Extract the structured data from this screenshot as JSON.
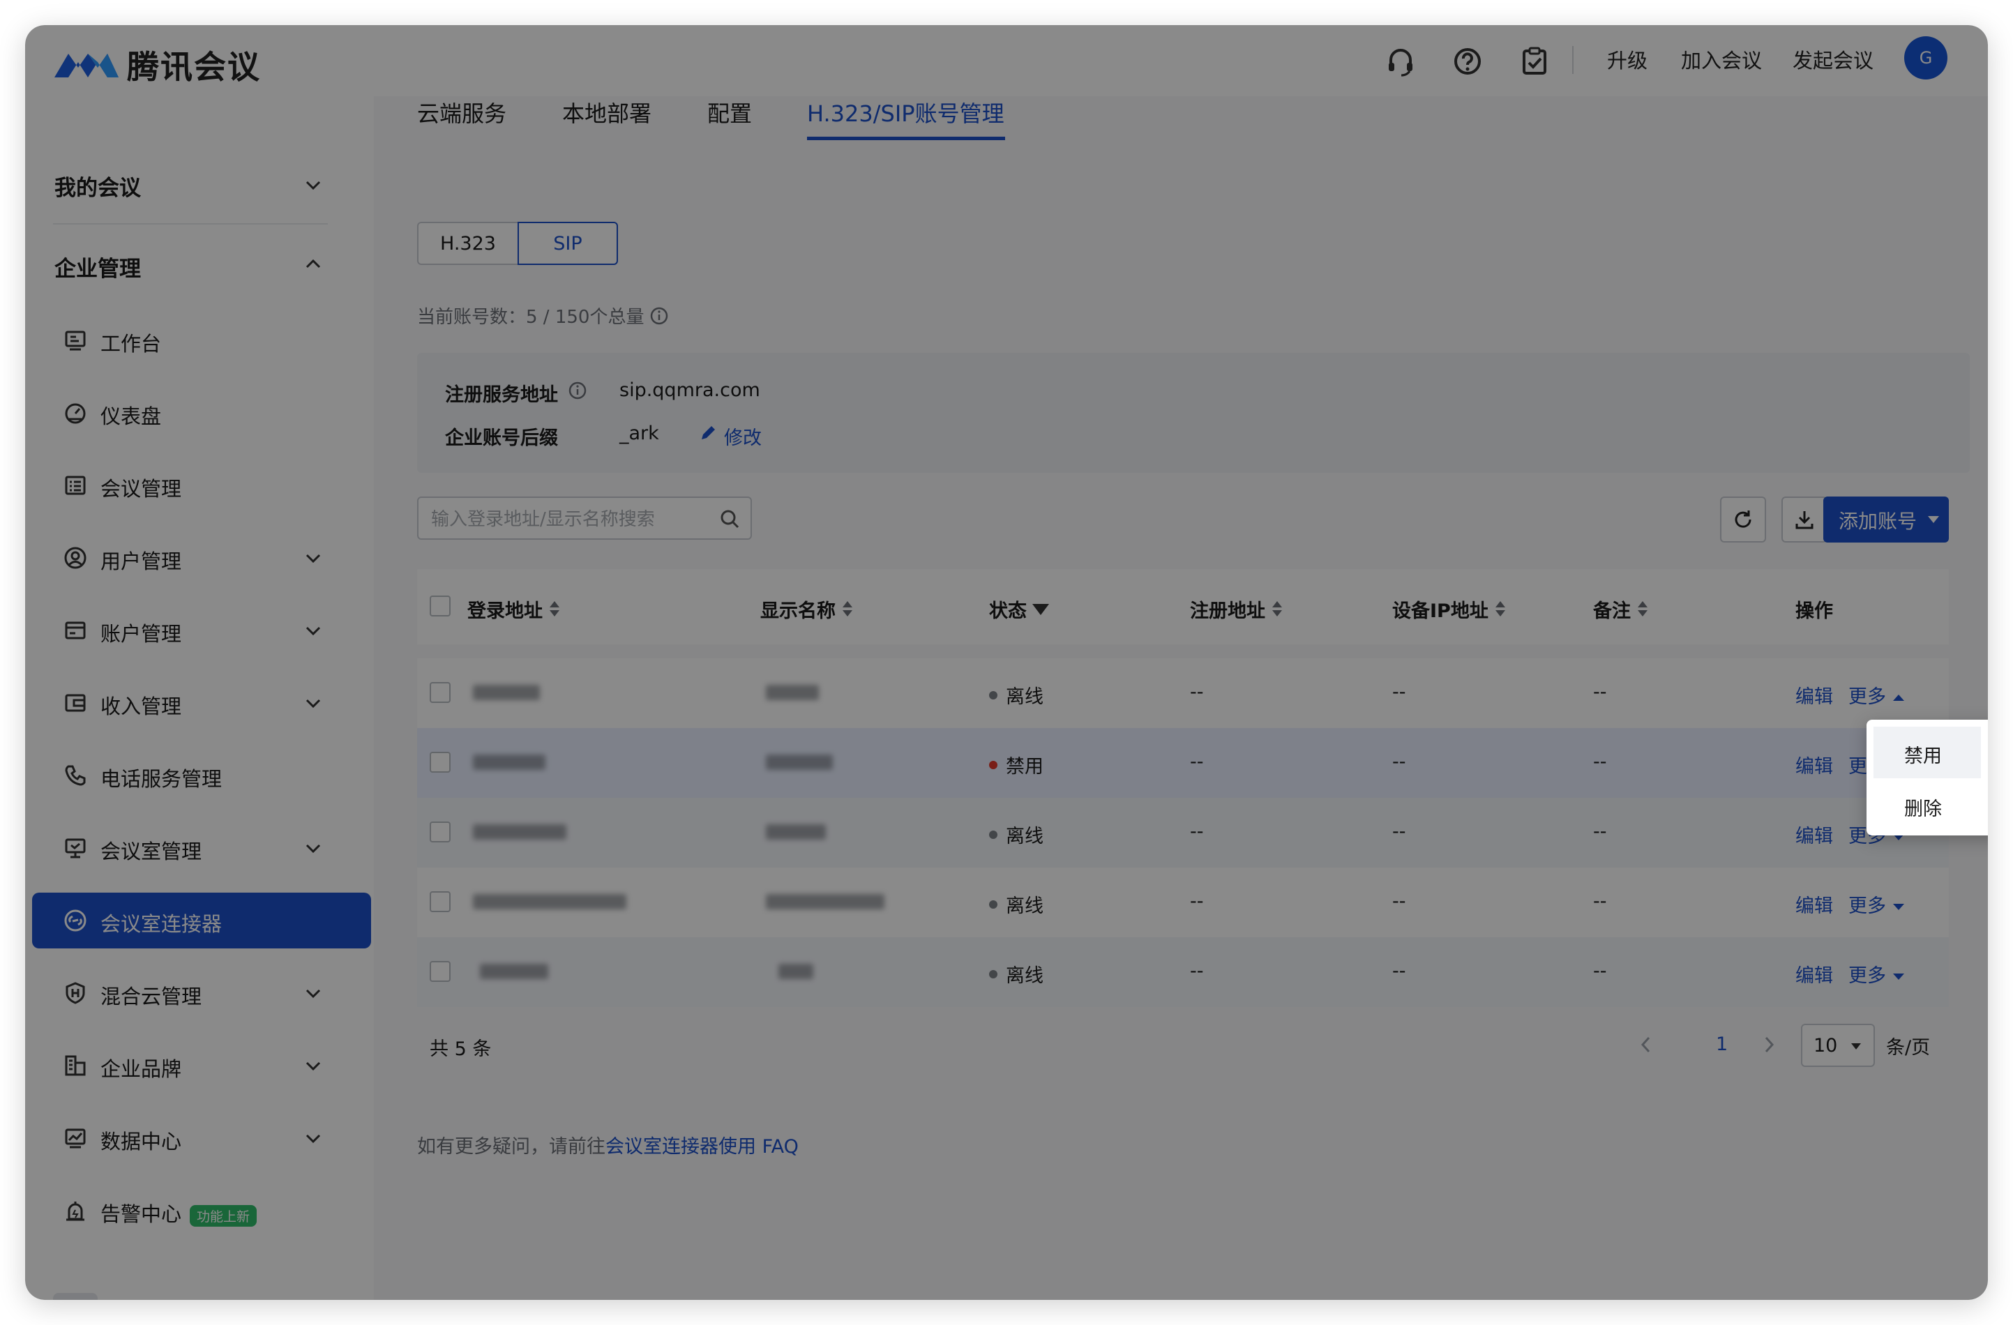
{
  "app": {
    "title": "腾讯会议"
  },
  "top_nav": {
    "icons": [
      "headset-icon",
      "help-icon",
      "clipboard-check-icon"
    ],
    "upgrade": "升级",
    "join": "加入会议",
    "start": "发起会议",
    "avatar_initial": "G"
  },
  "sidebar": {
    "my_meetings": "我的会议",
    "enterprise": "企业管理",
    "items": [
      {
        "label": "工作台",
        "icon": "workbench-icon",
        "expandable": false
      },
      {
        "label": "仪表盘",
        "icon": "dashboard-icon",
        "expandable": false
      },
      {
        "label": "会议管理",
        "icon": "meeting-list-icon",
        "expandable": false
      },
      {
        "label": "用户管理",
        "icon": "user-icon",
        "expandable": true
      },
      {
        "label": "账户管理",
        "icon": "account-card-icon",
        "expandable": true
      },
      {
        "label": "收入管理",
        "icon": "income-icon",
        "expandable": true
      },
      {
        "label": "电话服务管理",
        "icon": "phone-icon",
        "expandable": false
      },
      {
        "label": "会议室管理",
        "icon": "meeting-room-icon",
        "expandable": true
      },
      {
        "label": "会议室连接器",
        "icon": "connector-icon",
        "expandable": false,
        "active": true
      },
      {
        "label": "混合云管理",
        "icon": "hybrid-cloud-icon",
        "expandable": true
      },
      {
        "label": "企业品牌",
        "icon": "brand-icon",
        "expandable": true
      },
      {
        "label": "数据中心",
        "icon": "data-center-icon",
        "expandable": true
      },
      {
        "label": "告警中心",
        "icon": "alarm-icon",
        "expandable": false,
        "badge": "功能上新"
      }
    ]
  },
  "tabs": [
    {
      "label": "云端服务",
      "active": false
    },
    {
      "label": "本地部署",
      "active": false
    },
    {
      "label": "配置",
      "active": false
    },
    {
      "label": "H.323/SIP账号管理",
      "active": true
    }
  ],
  "segment": {
    "h323": "H.323",
    "sip": "SIP",
    "selected": "SIP"
  },
  "account_count": "当前账号数：5 / 150个总量",
  "info": {
    "register_label": "注册服务地址",
    "register_value": "sip.qqmra.com",
    "suffix_label": "企业账号后缀",
    "suffix_value": "_ark",
    "edit_label": "修改"
  },
  "search": {
    "placeholder": "输入登录地址/显示名称搜索",
    "value": ""
  },
  "actions": {
    "add_label": "添加账号"
  },
  "table": {
    "columns": [
      "登录地址",
      "显示名称",
      "状态",
      "注册地址",
      "设备IP地址",
      "备注",
      "操作"
    ],
    "rows": [
      {
        "status": "离线",
        "status_color": "#7d8188",
        "register": "--",
        "ip": "--",
        "note": "--",
        "edit": "编辑",
        "more": "更多"
      },
      {
        "status": "禁用",
        "status_color": "#e0382c",
        "register": "--",
        "ip": "--",
        "note": "--",
        "edit": "编辑",
        "more": "更多"
      },
      {
        "status": "离线",
        "status_color": "#7d8188",
        "register": "--",
        "ip": "--",
        "note": "--",
        "edit": "编辑",
        "more": "更多"
      },
      {
        "status": "离线",
        "status_color": "#7d8188",
        "register": "--",
        "ip": "--",
        "note": "--",
        "edit": "编辑",
        "more": "更多"
      },
      {
        "status": "离线",
        "status_color": "#7d8188",
        "register": "--",
        "ip": "--",
        "note": "--",
        "edit": "编辑",
        "more": "更多"
      }
    ]
  },
  "dropdown": {
    "items": [
      "禁用",
      "删除"
    ]
  },
  "pagination": {
    "total": "共 5 条",
    "current_page": "1",
    "page_size": "10",
    "unit": "条/页"
  },
  "faq": {
    "prefix": "如有更多疑问，请前往",
    "link": "会议室连接器使用 FAQ"
  },
  "colors": {
    "accent": "#1c50c9",
    "disabled_dot": "#e0382c",
    "offline_dot": "#7d8188",
    "badge": "#2fbd6a"
  }
}
